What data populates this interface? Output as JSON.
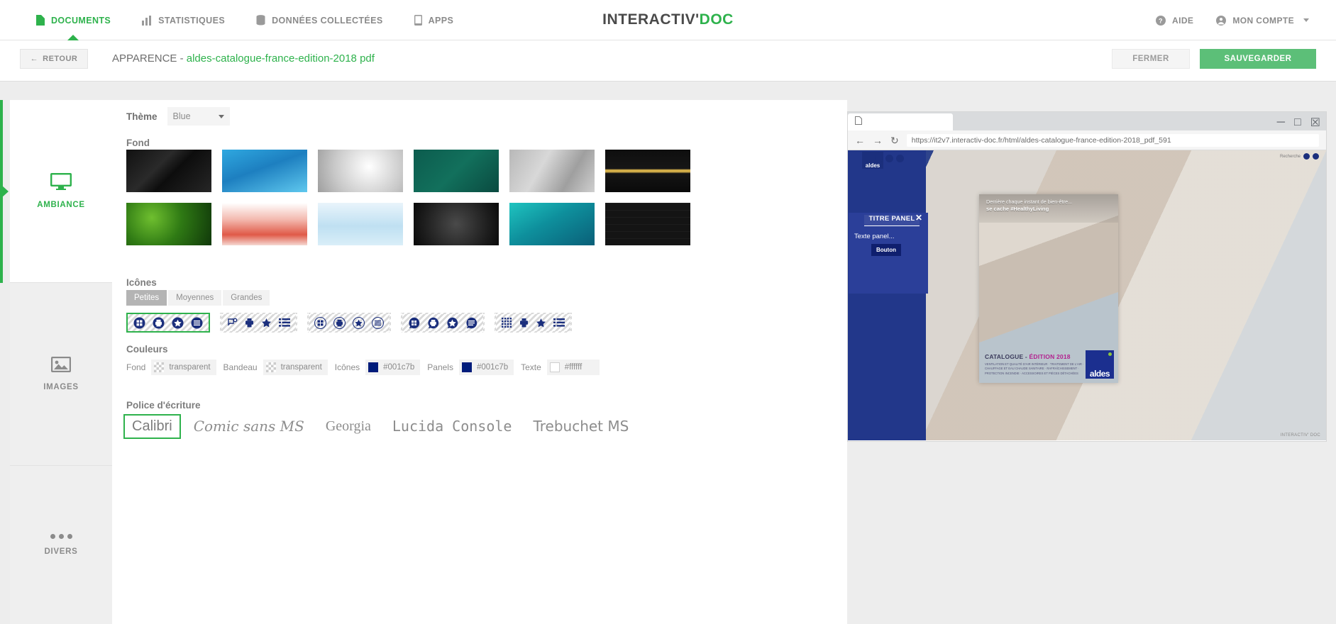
{
  "topnav": {
    "items": [
      {
        "label": "DOCUMENTS",
        "icon": "document-icon",
        "active": true
      },
      {
        "label": "STATISTIQUES",
        "icon": "chart-icon",
        "active": false
      },
      {
        "label": "DONNÉES COLLECTÉES",
        "icon": "database-icon",
        "active": false
      },
      {
        "label": "APPS",
        "icon": "mobile-icon",
        "active": false
      }
    ],
    "brand_primary": "INTERACTIV'",
    "brand_accent": "DOC",
    "help_label": "AIDE",
    "account_label": "MON COMPTE"
  },
  "subbar": {
    "back_label": "RETOUR",
    "title_prefix": "APPARENCE - ",
    "title_doc": "aldes-catalogue-france-edition-2018 pdf",
    "close_label": "FERMER",
    "save_label": "SAUVEGARDER"
  },
  "sidebar": {
    "items": [
      {
        "label": "AMBIANCE",
        "icon": "monitor-icon",
        "active": true
      },
      {
        "label": "IMAGES",
        "icon": "image-icon",
        "active": false
      },
      {
        "label": "DIVERS",
        "icon": "ellipsis-icon",
        "active": false
      }
    ]
  },
  "main": {
    "theme_label": "Thème",
    "theme_value": "Blue",
    "fond_label": "Fond",
    "backgrounds": [
      {
        "name": "dark-geometric",
        "css": "linear-gradient(135deg,#111 0%,#2a2a2a 38%,#0d0d0d 55%,#262626 100%)"
      },
      {
        "name": "blue-bokeh",
        "css": "linear-gradient(160deg,#2fa8e0 0%,#1d7fc0 45%,#5fc8ee 100%)"
      },
      {
        "name": "grey-gradient",
        "css": "radial-gradient(circle at 60% 40%,#ffffff 0%,#c9c9c9 60%,#9e9e9e 100%)"
      },
      {
        "name": "teal-texture",
        "css": "linear-gradient(135deg,#0c5c4e 0%,#12705c 50%,#0a4a40 100%)"
      },
      {
        "name": "grey-polygon",
        "css": "linear-gradient(120deg,#b8b8b8 0%,#d8d8d8 38%,#9f9f9f 70%,#cfcfcf 100%)"
      },
      {
        "name": "black-gold-line",
        "css": "linear-gradient(180deg,#0e0e0e 0%,#161616 45%,#d8b24a 48%,#d8b24a 52%,#141414 56%,#0a0a0a 100%)"
      },
      {
        "name": "green-leaves",
        "css": "radial-gradient(circle at 30% 35%,#6fbf2f 0%,#2f7a14 45%,#10380a 100%)"
      },
      {
        "name": "red-bokeh",
        "css": "linear-gradient(180deg,#ffffff 0%,#f3b7ad 40%,#e05a48 75%,#f5d8d2 100%)"
      },
      {
        "name": "light-clouds",
        "css": "linear-gradient(180deg,#e9f4fb 0%,#bfe0f2 55%,#d9eef8 100%)"
      },
      {
        "name": "dark-grain",
        "css": "radial-gradient(circle at 50% 50%,#4a4a4a 0%,#1c1c1c 70%,#0a0a0a 100%)"
      },
      {
        "name": "turquoise-water",
        "css": "linear-gradient(150deg,#1fc4c0 0%,#0e8f9c 45%,#0a5f78 100%)"
      },
      {
        "name": "dark-squares",
        "css": "repeating-linear-gradient(0deg,#141414 0 9px,#1d1d1d 9px 10px), repeating-linear-gradient(90deg,#141414 0 9px,#1d1d1d 9px 10px)"
      }
    ],
    "icones_label": "Icônes",
    "size_tabs": [
      {
        "label": "Petites",
        "active": true
      },
      {
        "label": "Moyennes",
        "active": false
      },
      {
        "label": "Grandes",
        "active": false
      }
    ],
    "icon_sets": [
      {
        "name": "filled-round-set",
        "selected": true
      },
      {
        "name": "outline-flat-set",
        "selected": false
      },
      {
        "name": "circle-outline-set",
        "selected": false
      },
      {
        "name": "filled-bubble-set",
        "selected": false
      },
      {
        "name": "grid-dots-set",
        "selected": false
      }
    ],
    "couleurs_label": "Couleurs",
    "colors": [
      {
        "label": "Fond",
        "value": "transparent",
        "swatch": "checker"
      },
      {
        "label": "Bandeau",
        "value": "transparent",
        "swatch": "checker"
      },
      {
        "label": "Icônes",
        "value": "#001c7b",
        "swatch": "#001c7b"
      },
      {
        "label": "Panels",
        "value": "#001c7b",
        "swatch": "#001c7b"
      },
      {
        "label": "Texte",
        "value": "#ffffff",
        "swatch": "#ffffff"
      }
    ],
    "police_label": "Police d'écriture",
    "fonts": [
      {
        "label": "Calibri",
        "selected": true
      },
      {
        "label": "Comic sans MS",
        "selected": false
      },
      {
        "label": "Georgia",
        "selected": false
      },
      {
        "label": "Lucida Console",
        "selected": false
      },
      {
        "label": "Trebuchet MS",
        "selected": false
      }
    ]
  },
  "preview": {
    "url": "https://it2v7.interactiv-doc.fr/html/aldes-catalogue-france-edition-2018_pdf_591",
    "panel": {
      "title": "TITRE PANEL",
      "text": "Texte panel...",
      "button": "Bouton",
      "close": "✕"
    },
    "cover": {
      "tagline_line1": "Derrière chaque instant de bien-être...",
      "tagline_line2": "se cache #HealthyLiving",
      "heading_main": "CATALOGUE - ",
      "heading_accent": "ÉDITION 2018",
      "subtext": "VENTILATION ET QUALITÉ D'AIR INTÉRIEUR · TRAITEMENT DE L'AIR · CHAUFFAGE ET EAU CHAUDE SANITAIRE · RAFRAÎCHISSEMENT · PROTECTION INCENDIE · ACCESSOIRES ET PIÈCES DÉTACHÉES",
      "brand": "aldes",
      "footer_brand": "INTERACTIV' DOC"
    }
  }
}
